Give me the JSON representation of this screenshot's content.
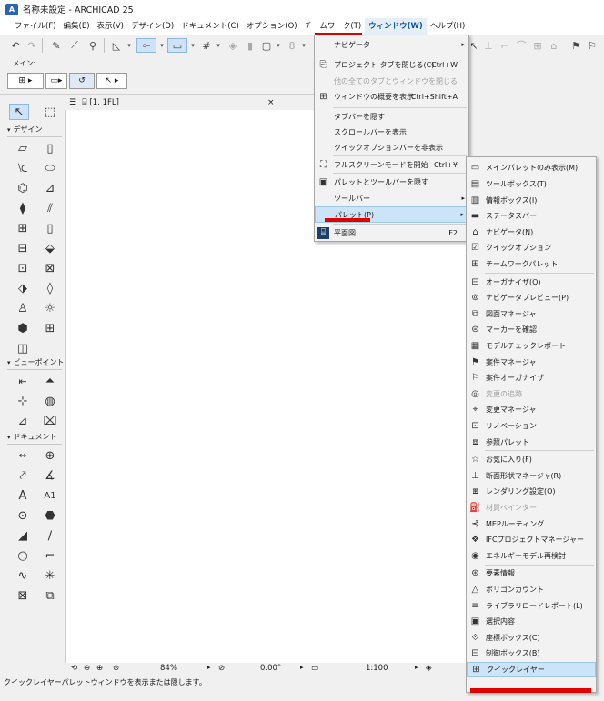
{
  "window": {
    "title": "名称未設定 - ARCHICAD 25"
  },
  "menubar": {
    "items": [
      {
        "label": "ファイル(F)"
      },
      {
        "label": "編集(E)"
      },
      {
        "label": "表示(V)"
      },
      {
        "label": "デザイン(D)"
      },
      {
        "label": "ドキュメント(C)"
      },
      {
        "label": "オプション(O)"
      },
      {
        "label": "チームワーク(T)"
      },
      {
        "label": "ウィンドウ(W)"
      },
      {
        "label": "ヘルプ(H)"
      }
    ]
  },
  "infobox": {
    "label": "メイン:"
  },
  "toolbox": {
    "design_header": "デザイン",
    "viewpoint_header": "ビューポイント",
    "document_header": "ドキュメント",
    "text_tool_glyph": "A",
    "label_tool_glyph": "A1"
  },
  "view_tab": {
    "label": "[1. 1FL]",
    "close": "×"
  },
  "navbar": {
    "zoom": "84%",
    "angle": "0.00°",
    "scale": "1:100"
  },
  "status": {
    "text": "クイックレイヤーパレットウィンドウを表示または隠します。"
  },
  "window_menu": {
    "items": [
      {
        "label": "ナビゲータ",
        "shortcut": "",
        "submenu": true,
        "disabled": false
      },
      {
        "label": "プロジェクト タブを閉じる(C)",
        "shortcut": "Ctrl+W",
        "submenu": false,
        "disabled": false
      },
      {
        "label": "他の全てのタブとウィンドウを閉じる",
        "shortcut": "",
        "submenu": false,
        "disabled": true
      },
      {
        "label": "ウィンドウの概要を表示",
        "shortcut": "Ctrl+Shift+A",
        "submenu": false,
        "disabled": false
      },
      {
        "label": "タブバーを隠す",
        "shortcut": "",
        "submenu": false,
        "disabled": false
      },
      {
        "label": "スクロールバーを表示",
        "shortcut": "",
        "submenu": false,
        "disabled": false
      },
      {
        "label": "クイックオプションバーを非表示",
        "shortcut": "",
        "submenu": false,
        "disabled": false
      },
      {
        "label": "フルスクリーンモードを開始",
        "shortcut": "Ctrl+¥",
        "submenu": false,
        "disabled": false
      },
      {
        "label": "パレットとツールバーを隠す",
        "shortcut": "",
        "submenu": false,
        "disabled": false
      },
      {
        "label": "ツールバー",
        "shortcut": "",
        "submenu": true,
        "disabled": false
      },
      {
        "label": "パレット(P)",
        "shortcut": "",
        "submenu": true,
        "disabled": false
      },
      {
        "label": "平面図",
        "shortcut": "F2",
        "submenu": false,
        "disabled": false
      }
    ]
  },
  "palette_menu": {
    "items": [
      {
        "label": "メインパレットのみ表示(M)",
        "disabled": false
      },
      {
        "label": "ツールボックス(T)",
        "disabled": false
      },
      {
        "label": "情報ボックス(I)",
        "disabled": false
      },
      {
        "label": "ステータスバー",
        "disabled": false
      },
      {
        "label": "ナビゲータ(N)",
        "disabled": false
      },
      {
        "label": "クイックオプション",
        "disabled": false
      },
      {
        "label": "チームワークパレット",
        "disabled": false
      },
      {
        "label": "オーガナイザ(O)",
        "disabled": false
      },
      {
        "label": "ナビゲータプレビュー(P)",
        "disabled": false
      },
      {
        "label": "図面マネージャ",
        "disabled": false
      },
      {
        "label": "マーカーを確認",
        "disabled": false
      },
      {
        "label": "モデルチェックレポート",
        "disabled": false
      },
      {
        "label": "案件マネージャ",
        "disabled": false
      },
      {
        "label": "案件オーガナイザ",
        "disabled": false
      },
      {
        "label": "変更の追跡",
        "disabled": true
      },
      {
        "label": "変更マネージャ",
        "disabled": false
      },
      {
        "label": "リノベーション",
        "disabled": false
      },
      {
        "label": "参照パレット",
        "disabled": false
      },
      {
        "label": "お気に入り(F)",
        "disabled": false
      },
      {
        "label": "断面形状マネージャ(R)",
        "disabled": false
      },
      {
        "label": "レンダリング設定(O)",
        "disabled": false
      },
      {
        "label": "材質ペインター",
        "disabled": true
      },
      {
        "label": "MEPルーティング",
        "disabled": false
      },
      {
        "label": "IFCプロジェクトマネージャー",
        "disabled": false
      },
      {
        "label": "エネルギーモデル再検討",
        "disabled": false
      },
      {
        "label": "要素情報",
        "disabled": false
      },
      {
        "label": "ポリゴンカウント",
        "disabled": false
      },
      {
        "label": "ライブラリロードレポート(L)",
        "disabled": false
      },
      {
        "label": "選択内容",
        "disabled": false
      },
      {
        "label": "座標ボックス(C)",
        "disabled": false
      },
      {
        "label": "制御ボックス(B)",
        "disabled": false
      },
      {
        "label": "クイックレイヤー",
        "disabled": false
      }
    ]
  },
  "colors": {
    "highlight": "#cce4f7",
    "annotation_red": "#e00000",
    "active_menu": "#0b57a0"
  }
}
